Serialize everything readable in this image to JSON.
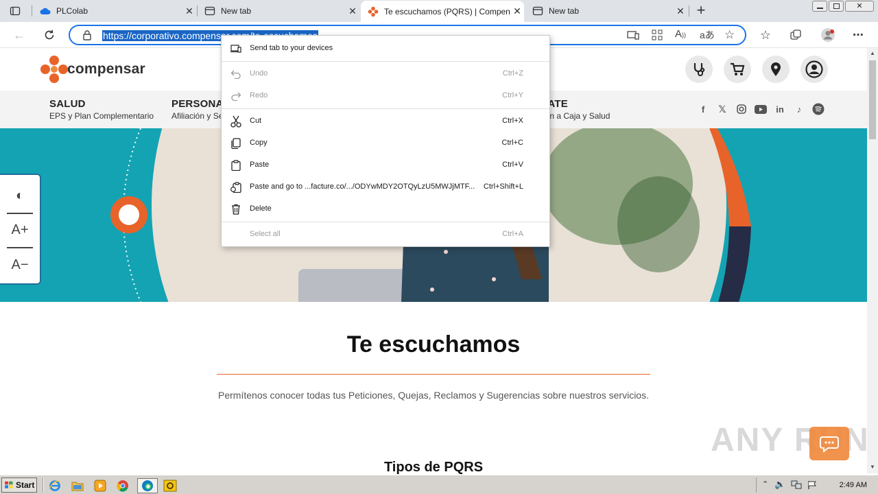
{
  "browser": {
    "tabs": [
      {
        "title": "PLColab",
        "active": false
      },
      {
        "title": "New tab",
        "active": false
      },
      {
        "title": "Te escuchamos (PQRS) | Compensar",
        "active": true
      },
      {
        "title": "New tab",
        "active": false
      }
    ],
    "new_tab_symbol": "+",
    "address": "https://corporativo.compensar.com/te-escuchamos"
  },
  "context_menu": {
    "items": [
      {
        "label": "Send tab to your devices",
        "shortcut": "",
        "icon": "devices-icon",
        "disabled": false
      },
      {
        "label": "Undo",
        "shortcut": "Ctrl+Z",
        "icon": "undo-icon",
        "disabled": true
      },
      {
        "label": "Redo",
        "shortcut": "Ctrl+Y",
        "icon": "redo-icon",
        "disabled": true
      },
      {
        "label": "Cut",
        "shortcut": "Ctrl+X",
        "icon": "scissors-icon",
        "disabled": false
      },
      {
        "label": "Copy",
        "shortcut": "Ctrl+C",
        "icon": "copy-icon",
        "disabled": false
      },
      {
        "label": "Paste",
        "shortcut": "Ctrl+V",
        "icon": "paste-icon",
        "disabled": false
      },
      {
        "label": "Paste and go to ...facture.co/.../ODYwMDY2OTQyLzU5MWJjMTF...",
        "shortcut": "Ctrl+Shift+L",
        "icon": "paste-go-icon",
        "disabled": false
      },
      {
        "label": "Delete",
        "shortcut": "",
        "icon": "trash-icon",
        "disabled": false
      },
      {
        "label": "Select all",
        "shortcut": "Ctrl+A",
        "icon": "",
        "disabled": true
      }
    ]
  },
  "site": {
    "logo_text": "compensar",
    "brand_color": "#e8632a",
    "nav": [
      {
        "main": "SALUD",
        "sub": "EPS y Plan Complementario"
      },
      {
        "main": "PERSONAS",
        "sub": "Afiliación y Servicios"
      },
      {
        "main": "AFÍLIATE",
        "sub": "Afiliación a Caja y Salud"
      }
    ],
    "accessibility": {
      "contrast": "◐",
      "increase": "A+",
      "decrease": "A−"
    },
    "title": "Te escuchamos",
    "description": "Permítenos conocer todas tus Peticiones, Quejas, Reclamos y Sugerencias sobre nuestros servicios.",
    "section_heading": "Tipos de PQRS"
  },
  "watermark": "ANY RUN",
  "taskbar": {
    "start_label": "Start",
    "clock": "2:49 AM"
  }
}
